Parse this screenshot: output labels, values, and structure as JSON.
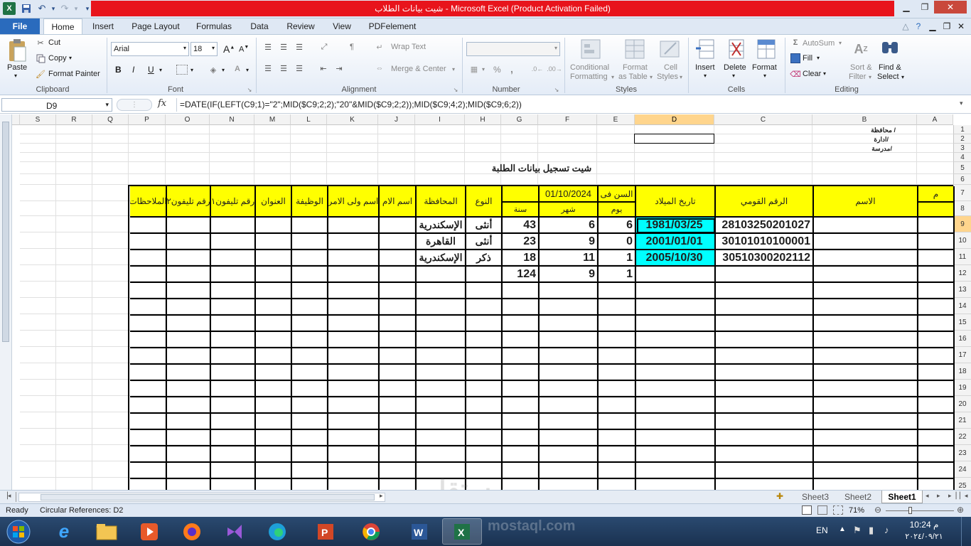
{
  "window": {
    "title": "شيت بيانات الطلاب  -  Microsoft Excel (Product Activation Failed)"
  },
  "tabs": [
    "File",
    "Home",
    "Insert",
    "Page Layout",
    "Formulas",
    "Data",
    "Review",
    "View",
    "PDFelement"
  ],
  "clipboard": {
    "paste": "Paste",
    "cut": "Cut",
    "copy": "Copy",
    "format_painter": "Format Painter",
    "label": "Clipboard"
  },
  "font": {
    "name": "Arial",
    "size": "18",
    "bold": "B",
    "italic": "I",
    "underline": "U",
    "label": "Font"
  },
  "alignment": {
    "wrap": "Wrap Text",
    "merge": "Merge & Center",
    "label": "Alignment"
  },
  "number": {
    "format": "",
    "percent": "%",
    "comma": ",",
    "label": "Number"
  },
  "styles": {
    "conditional": "Conditional",
    "conditional2": "Formatting",
    "format_table": "Format",
    "format_table2": "as Table",
    "cell_styles": "Cell",
    "cell_styles2": "Styles",
    "label": "Styles"
  },
  "cells": {
    "insert": "Insert",
    "delete": "Delete",
    "format": "Format",
    "label": "Cells"
  },
  "editing": {
    "autosum": "AutoSum",
    "fill": "Fill",
    "clear": "Clear",
    "sort": "Sort &",
    "sort2": "Filter",
    "find": "Find &",
    "find2": "Select",
    "label": "Editing"
  },
  "formula_bar": {
    "name_box": "D9",
    "fx": "fx",
    "formula": "=DATE(IF(LEFT(C9;1)=\"2\";MID($C9;2;2);\"20\"&MID($C9;2;2));MID($C9;4;2);MID($C9;6;2))"
  },
  "columns": [
    "S",
    "R",
    "Q",
    "P",
    "O",
    "N",
    "M",
    "L",
    "K",
    "J",
    "I",
    "H",
    "G",
    "F",
    "E",
    "D",
    "C",
    "B",
    "A"
  ],
  "rows": [
    "1",
    "2",
    "3",
    "4",
    "5",
    "6",
    "7",
    "8",
    "9",
    "10",
    "11",
    "12",
    "13",
    "14",
    "15",
    "16",
    "17",
    "18",
    "19",
    "20",
    "21",
    "22",
    "23",
    "24",
    "25"
  ],
  "header_notes": [
    "محافظة /",
    "ادارة/",
    "مدرسة/"
  ],
  "sheet_title": "شيت تسجيل بيانات الطلبة",
  "table_headers": {
    "m": "م",
    "name": "الاسم",
    "national_id": "الرقم القومي",
    "birth_date": "تاريخ الميلاد",
    "age_in": "السن فى",
    "ref_date": "01/10/2024",
    "day": "يوم",
    "month": "شهر",
    "year": "سنة",
    "gender": "النوع",
    "governorate": "المحافظة",
    "mother": "اسم الام",
    "guardian": "اسم ولى الامر",
    "job": "الوظيفة",
    "address": "العنوان",
    "phone1": "رقم تليفون١",
    "phone2": "رقم تليفون٢",
    "notes": "الملاحظات"
  },
  "records": [
    {
      "national_id": "28103250201027",
      "birth_date": "1981/03/25",
      "day": "6",
      "month": "6",
      "year": "43",
      "gender": "أنثى",
      "governorate": "الإسكندرية"
    },
    {
      "national_id": "30101010100001",
      "birth_date": "2001/01/01",
      "day": "0",
      "month": "9",
      "year": "23",
      "gender": "أنثى",
      "governorate": "القاهرة"
    },
    {
      "national_id": "30510300202112",
      "birth_date": "2005/10/30",
      "day": "1",
      "month": "11",
      "year": "18",
      "gender": "ذكر",
      "governorate": "الإسكندرية"
    },
    {
      "national_id": "",
      "birth_date": "",
      "day": "1",
      "month": "9",
      "year": "124",
      "gender": "",
      "governorate": ""
    }
  ],
  "sheet_tabs": [
    "Sheet3",
    "Sheet2",
    "Sheet1"
  ],
  "status": {
    "ready": "Ready",
    "circular": "Circular References: D2",
    "zoom": "71%"
  },
  "taskbar": {
    "lang": "EN",
    "time": "10:24 م",
    "date": "٢٠٢٤/٠٩/٢١"
  },
  "watermark": "mostaql.com"
}
